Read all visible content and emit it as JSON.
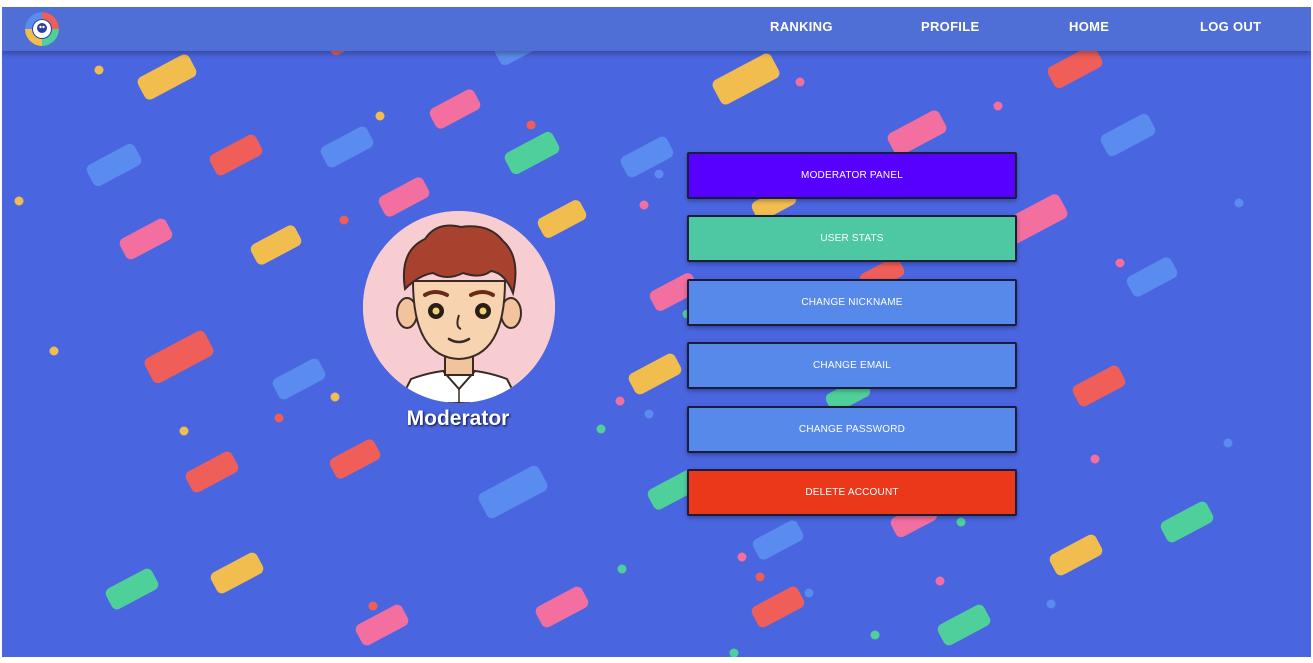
{
  "nav": {
    "logo_icon": "app-logo-icon",
    "links": [
      "RANKING",
      "PROFILE",
      "HOME",
      "LOG OUT"
    ]
  },
  "profile": {
    "username": "Moderator",
    "avatar_icon": "cartoon-boy-avatar"
  },
  "menu": [
    {
      "label": "MODERATOR PANEL",
      "color": "#5800ff"
    },
    {
      "label": "USER STATS",
      "color": "#4dc8a2"
    },
    {
      "label": "CHANGE NICKNAME",
      "color": "#5689ea"
    },
    {
      "label": "CHANGE EMAIL",
      "color": "#5689ea"
    },
    {
      "label": "CHANGE PASSWORD",
      "color": "#5689ea"
    },
    {
      "label": "DELETE ACCOUNT",
      "color": "#eb371a"
    }
  ],
  "colors": {
    "background": "#4a65e0",
    "navbar": "#4f6fd6",
    "confetti": [
      "#f2bd4f",
      "#f26f9f",
      "#ef5e58",
      "#4fcf9a",
      "#5a8bee"
    ]
  }
}
